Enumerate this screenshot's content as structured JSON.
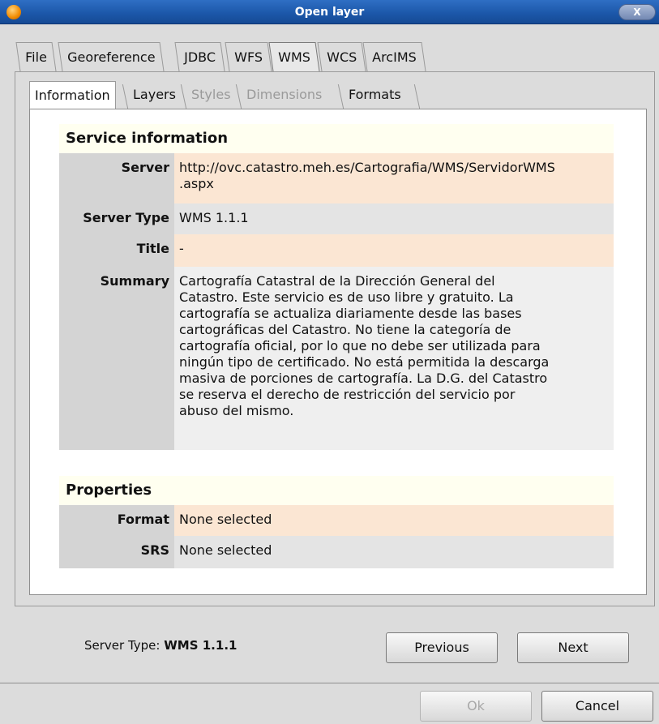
{
  "window": {
    "title": "Open layer",
    "close_label": "X"
  },
  "tabs": [
    {
      "label": "File"
    },
    {
      "label": "Georeference"
    },
    {
      "label": "JDBC"
    },
    {
      "label": "WFS"
    },
    {
      "label": "WMS"
    },
    {
      "label": "WCS"
    },
    {
      "label": "ArcIMS"
    }
  ],
  "active_tab": "WMS",
  "inner_tabs": [
    {
      "label": "Information",
      "state": "active"
    },
    {
      "label": "Layers",
      "state": "enabled"
    },
    {
      "label": "Styles",
      "state": "disabled"
    },
    {
      "label": "Dimensions",
      "state": "disabled"
    },
    {
      "label": "Formats",
      "state": "enabled"
    }
  ],
  "service_info": {
    "heading": "Service information",
    "server_label": "Server",
    "server_value_line1": "http://ovc.catastro.meh.es/Cartografia/WMS/ServidorWMS",
    "server_value_line2": ".aspx",
    "server_type_label": "Server Type",
    "server_type_value": "WMS 1.1.1",
    "title_label": "Title",
    "title_value": "-",
    "summary_label": "Summary",
    "summary_lines": [
      "Cartografía Catastral de la Dirección General del",
      "Catastro. Este servicio es de uso libre y gratuito. La",
      "cartografía se actualiza diariamente desde las bases",
      "cartográficas del Catastro. No tiene la categoría de",
      "cartografía oficial, por lo que no debe ser utilizada para",
      "ningún tipo de certificado. No está permitida la descarga",
      "masiva de porciones de cartografía. La D.G. del Catastro",
      "se reserva el derecho de restricción del servicio por",
      "abuso del mismo."
    ]
  },
  "properties": {
    "heading": "Properties",
    "format_label": "Format",
    "format_value": "None selected",
    "srs_label": "SRS",
    "srs_value": "None selected"
  },
  "footer": {
    "server_type_caption": "Server Type:",
    "server_type_value": "WMS 1.1.1",
    "previous_label": "Previous",
    "next_label": "Next",
    "ok_label": "Ok",
    "cancel_label": "Cancel"
  }
}
